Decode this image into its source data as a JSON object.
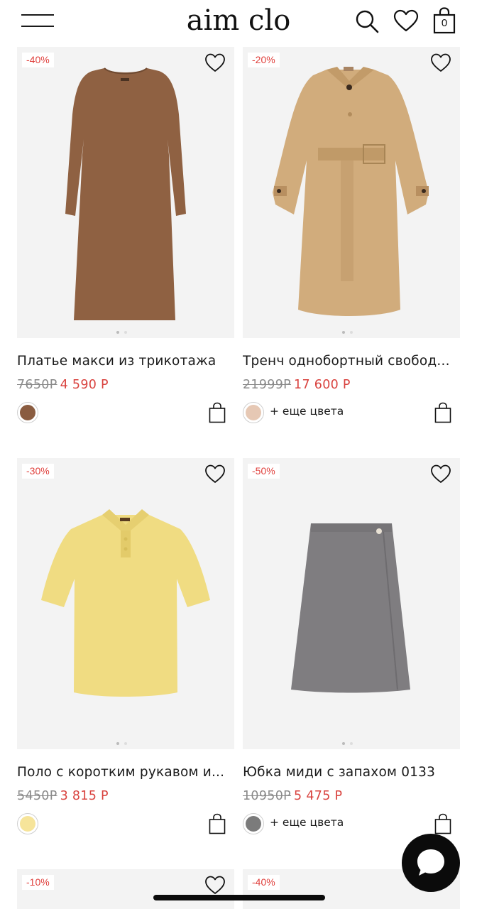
{
  "header": {
    "logo": "aim clo",
    "cart_count": "0",
    "icons": [
      "menu-icon",
      "search-icon",
      "heart-icon",
      "shopping-bag-icon"
    ]
  },
  "products": [
    {
      "badge": "-40%",
      "title": "Платье макси из трикотажа",
      "old_price": "7650Р",
      "new_price": "4 590 Р",
      "swatch_color": "#8a5c40",
      "more_colors": ""
    },
    {
      "badge": "-20%",
      "title": "Тренч однобортный свобод...",
      "old_price": "21999Р",
      "new_price": "17 600 Р",
      "swatch_color": "#e6c8b4",
      "more_colors": "+ еще цвета"
    },
    {
      "badge": "-30%",
      "title": "Поло с коротким рукавом и...",
      "old_price": "5450Р",
      "new_price": "3 815 Р",
      "swatch_color": "#f6e49a",
      "more_colors": ""
    },
    {
      "badge": "-50%",
      "title": "Юбка миди с запахом 0133",
      "old_price": "10950Р",
      "new_price": "5 475 Р",
      "swatch_color": "#7b7b7b",
      "more_colors": "+ еще цвета"
    },
    {
      "badge": "-10%"
    },
    {
      "badge": "-40%"
    }
  ],
  "colors": {
    "discount": "#d9433f",
    "photo_bg": "#f3f3f3",
    "chat_button": "#0b0b0b"
  }
}
